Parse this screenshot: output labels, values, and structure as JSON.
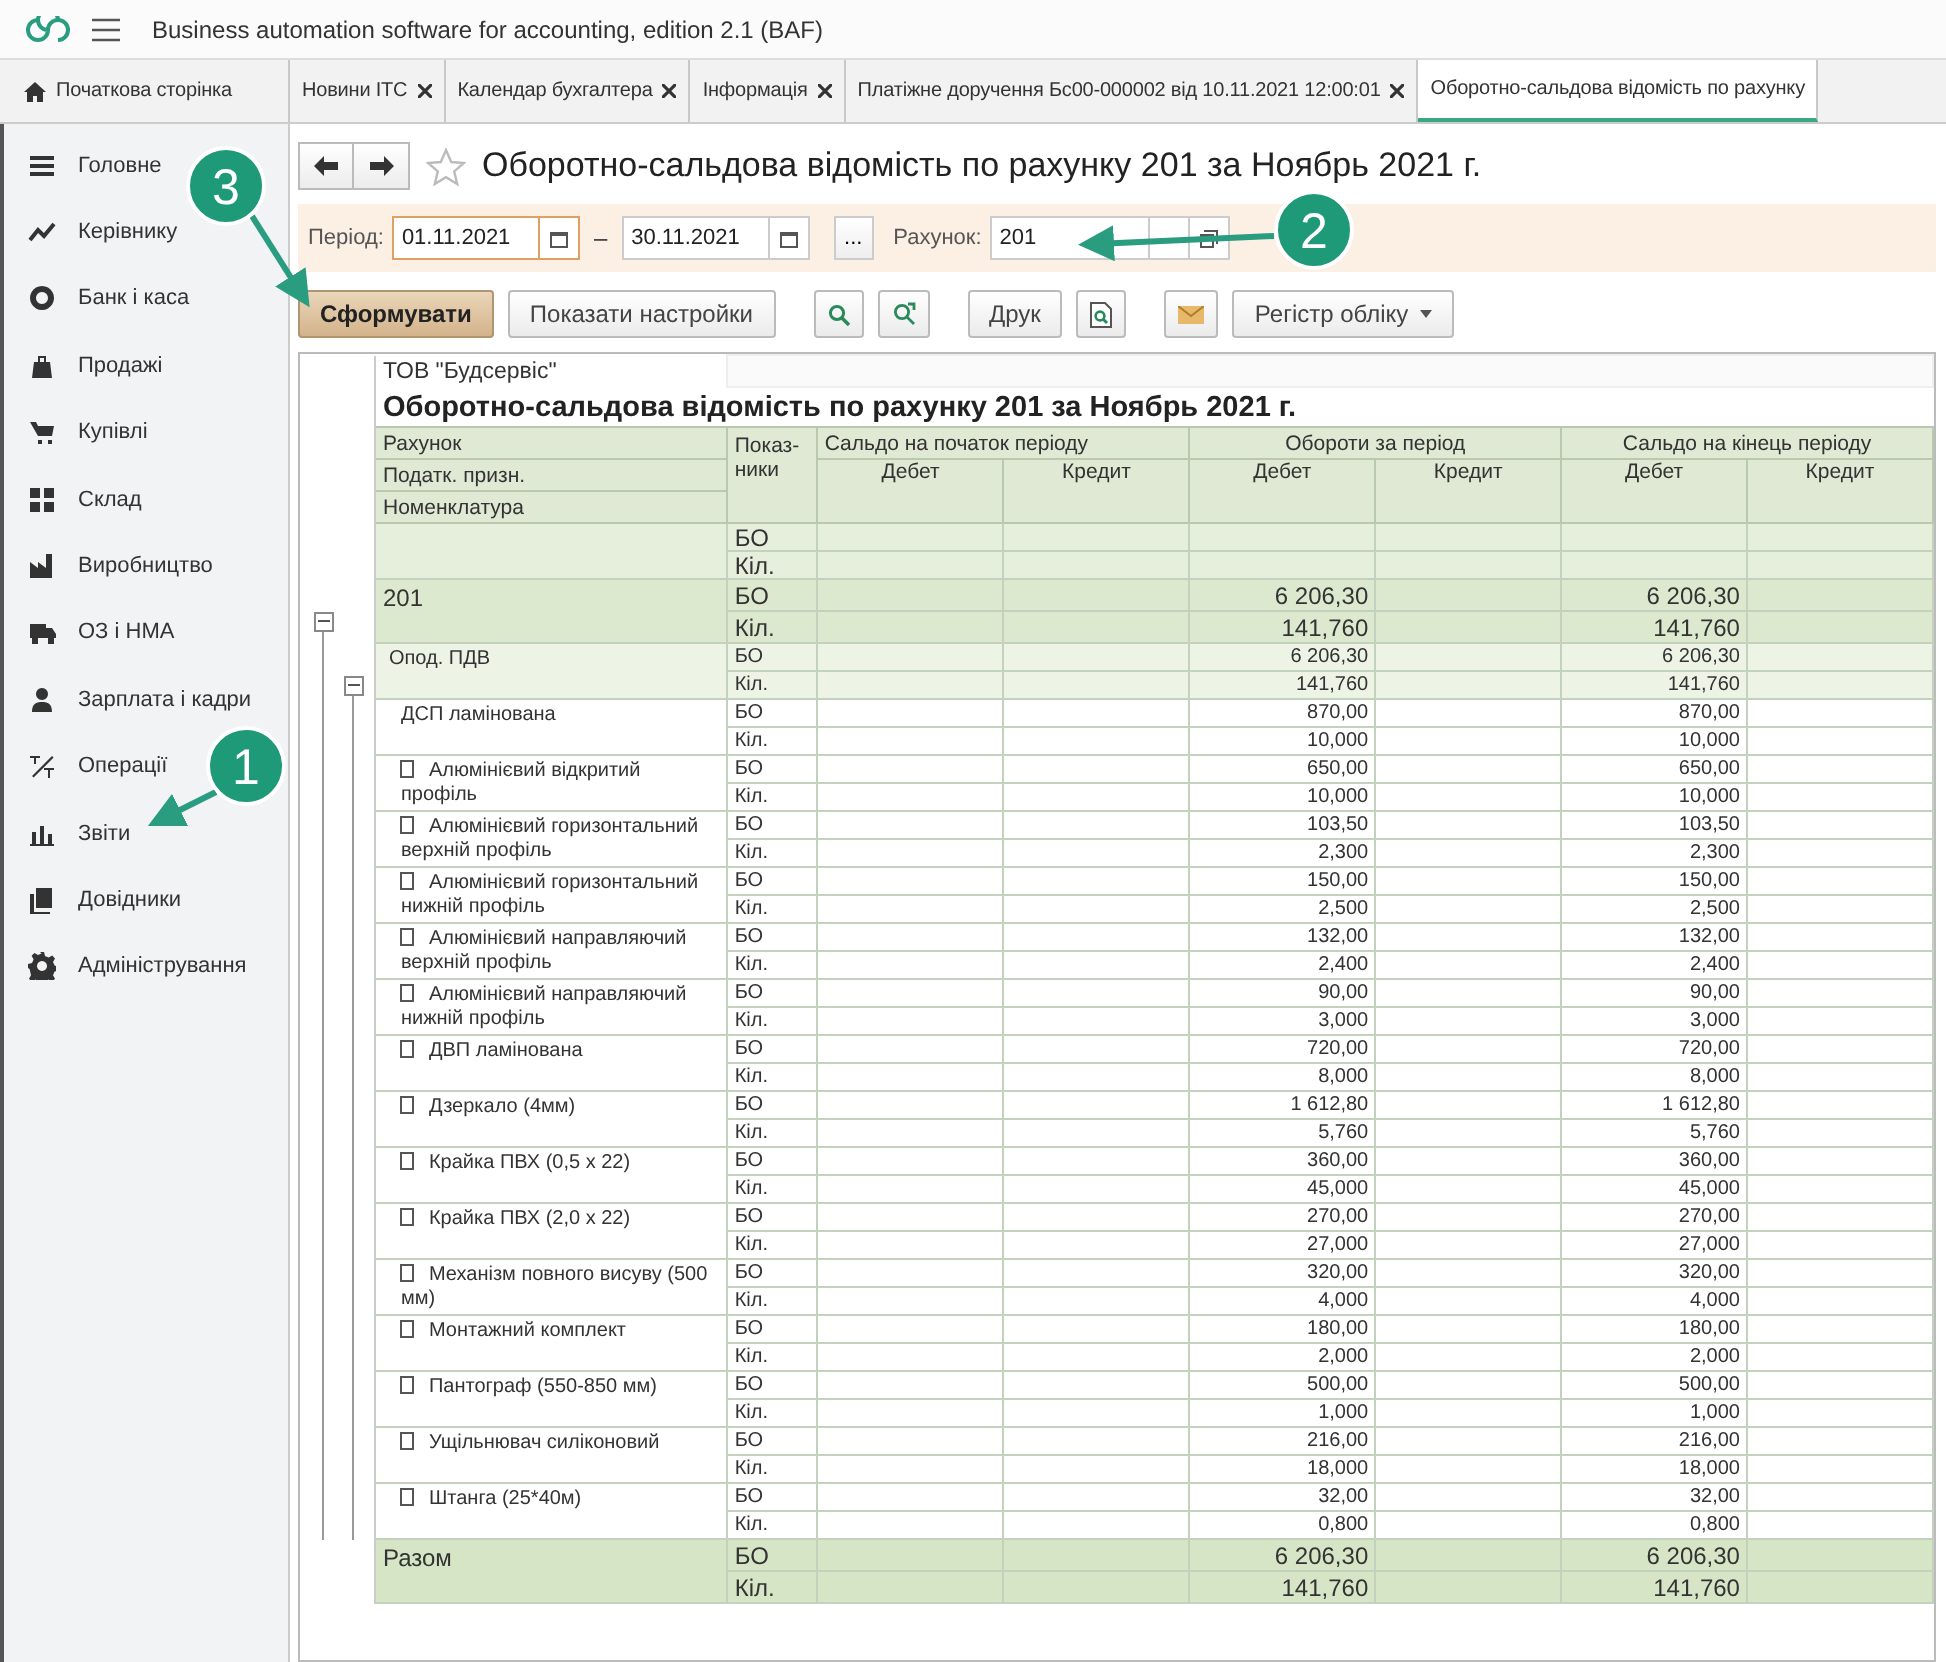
{
  "app": {
    "title": "Business automation software for accounting, edition 2.1 (BAF)"
  },
  "tabs": [
    {
      "label": "Початкова сторінка",
      "kind": "home",
      "closable": false,
      "selected": false
    },
    {
      "label": "Новини ІТС",
      "kind": "page",
      "closable": true,
      "selected": false
    },
    {
      "label": "Календар бухгалтера",
      "kind": "page",
      "closable": true,
      "selected": false
    },
    {
      "label": "Інформація",
      "kind": "page",
      "closable": true,
      "selected": false
    },
    {
      "label": "Платіжне доручення Бс00-000002 від 10.11.2021 12:00:01",
      "kind": "page",
      "closable": true,
      "selected": false
    },
    {
      "label": "Оборотно-сальдова відомість по рахунку",
      "kind": "page",
      "closable": false,
      "selected": true
    }
  ],
  "sidebar": {
    "items": [
      {
        "label": "Головне"
      },
      {
        "label": "Керівнику"
      },
      {
        "label": "Банк і каса"
      },
      {
        "label": "Продажі"
      },
      {
        "label": "Купівлі"
      },
      {
        "label": "Склад"
      },
      {
        "label": "Виробництво"
      },
      {
        "label": "ОЗ і НМА"
      },
      {
        "label": "Зарплата і кадри"
      },
      {
        "label": "Операції"
      },
      {
        "label": "Звіти"
      },
      {
        "label": "Довідники"
      },
      {
        "label": "Адміністрування"
      }
    ]
  },
  "form": {
    "title": "Оборотно-сальдова відомість по рахунку 201 за Ноябрь 2021 г."
  },
  "filters": {
    "period_label": "Період:",
    "date_from": {
      "value": "01.11.2021",
      "focused": true
    },
    "separator": "–",
    "date_to": {
      "value": "30.11.2021",
      "focused": false
    },
    "more_button": "...",
    "account_label": "Рахунок:",
    "account": "201"
  },
  "toolbar": [
    {
      "kind": "primary",
      "label": "Сформувати"
    },
    {
      "kind": "text",
      "label": "Показати настройки"
    },
    {
      "kind": "search"
    },
    {
      "kind": "search-refresh"
    },
    {
      "kind": "text",
      "label": "Друк"
    },
    {
      "kind": "preview"
    },
    {
      "kind": "mail"
    },
    {
      "kind": "dropdown",
      "label": "Регістр обліку"
    }
  ],
  "report": {
    "organization": "ТОВ \"Будсервіс\"",
    "title": "Оборотно-сальдова відомість по рахунку 201 за Ноябрь 2021 г.",
    "row_headers": [
      "Рахунок",
      "Податк. призн.",
      "Номенклатура"
    ],
    "indicator_header": "Показ-ники",
    "column_groups": [
      {
        "label": "Сальдо на початок періоду",
        "columns": [
          "Дебет",
          "Кредит"
        ]
      },
      {
        "label": "Обороти за період",
        "columns": [
          "Дебет",
          "Кредит"
        ]
      },
      {
        "label": "Сальдо на кінець періоду",
        "columns": [
          "Дебет",
          "Кредит"
        ]
      }
    ],
    "blank_row": {
      "lines": [
        {
          "indicator": "БО"
        },
        {
          "indicator": "Кіл."
        }
      ]
    },
    "accounts": [
      {
        "name": "201",
        "expanded": true,
        "lines": [
          {
            "indicator": "БО",
            "turnover_debit": "6 206,30",
            "closing_debit": "6 206,30"
          },
          {
            "indicator": "Кіл.",
            "turnover_debit": "141,760",
            "closing_debit": "141,760"
          }
        ],
        "children": [
          {
            "name": "Опод. ПДВ",
            "expanded": true,
            "lines": [
              {
                "indicator": "БО",
                "turnover_debit": "6 206,30",
                "closing_debit": "6 206,30"
              },
              {
                "indicator": "Кіл.",
                "turnover_debit": "141,760",
                "closing_debit": "141,760"
              }
            ],
            "children": [
              {
                "name": "ДСП ламінована",
                "marker": false,
                "lines": [
                  {
                    "indicator": "БО",
                    "turnover_debit": "870,00",
                    "closing_debit": "870,00"
                  },
                  {
                    "indicator": "Кіл.",
                    "turnover_debit": "10,000",
                    "closing_debit": "10,000"
                  }
                ]
              },
              {
                "name": "Алюмінієвий відкритий профіль",
                "marker": true,
                "lines": [
                  {
                    "indicator": "БО",
                    "turnover_debit": "650,00",
                    "closing_debit": "650,00"
                  },
                  {
                    "indicator": "Кіл.",
                    "turnover_debit": "10,000",
                    "closing_debit": "10,000"
                  }
                ]
              },
              {
                "name": "Алюмінієвий горизонтальний верхній профіль",
                "marker": true,
                "lines": [
                  {
                    "indicator": "БО",
                    "turnover_debit": "103,50",
                    "closing_debit": "103,50"
                  },
                  {
                    "indicator": "Кіл.",
                    "turnover_debit": "2,300",
                    "closing_debit": "2,300"
                  }
                ]
              },
              {
                "name": "Алюмінієвий горизонтальний нижній профіль",
                "marker": true,
                "lines": [
                  {
                    "indicator": "БО",
                    "turnover_debit": "150,00",
                    "closing_debit": "150,00"
                  },
                  {
                    "indicator": "Кіл.",
                    "turnover_debit": "2,500",
                    "closing_debit": "2,500"
                  }
                ]
              },
              {
                "name": "Алюмінієвий направляючий верхній профіль",
                "marker": true,
                "lines": [
                  {
                    "indicator": "БО",
                    "turnover_debit": "132,00",
                    "closing_debit": "132,00"
                  },
                  {
                    "indicator": "Кіл.",
                    "turnover_debit": "2,400",
                    "closing_debit": "2,400"
                  }
                ]
              },
              {
                "name": "Алюмінієвий направляючий нижній профіль",
                "marker": true,
                "lines": [
                  {
                    "indicator": "БО",
                    "turnover_debit": "90,00",
                    "closing_debit": "90,00"
                  },
                  {
                    "indicator": "Кіл.",
                    "turnover_debit": "3,000",
                    "closing_debit": "3,000"
                  }
                ]
              },
              {
                "name": "ДВП ламінована",
                "marker": true,
                "lines": [
                  {
                    "indicator": "БО",
                    "turnover_debit": "720,00",
                    "closing_debit": "720,00"
                  },
                  {
                    "indicator": "Кіл.",
                    "turnover_debit": "8,000",
                    "closing_debit": "8,000"
                  }
                ]
              },
              {
                "name": "Дзеркало (4мм)",
                "marker": true,
                "lines": [
                  {
                    "indicator": "БО",
                    "turnover_debit": "1 612,80",
                    "closing_debit": "1 612,80"
                  },
                  {
                    "indicator": "Кіл.",
                    "turnover_debit": "5,760",
                    "closing_debit": "5,760"
                  }
                ]
              },
              {
                "name": "Крайка ПВХ (0,5 х 22)",
                "marker": true,
                "lines": [
                  {
                    "indicator": "БО",
                    "turnover_debit": "360,00",
                    "closing_debit": "360,00"
                  },
                  {
                    "indicator": "Кіл.",
                    "turnover_debit": "45,000",
                    "closing_debit": "45,000"
                  }
                ]
              },
              {
                "name": "Крайка ПВХ (2,0 х 22)",
                "marker": true,
                "lines": [
                  {
                    "indicator": "БО",
                    "turnover_debit": "270,00",
                    "closing_debit": "270,00"
                  },
                  {
                    "indicator": "Кіл.",
                    "turnover_debit": "27,000",
                    "closing_debit": "27,000"
                  }
                ]
              },
              {
                "name": "Механізм повного висуву (500 мм)",
                "marker": true,
                "lines": [
                  {
                    "indicator": "БО",
                    "turnover_debit": "320,00",
                    "closing_debit": "320,00"
                  },
                  {
                    "indicator": "Кіл.",
                    "turnover_debit": "4,000",
                    "closing_debit": "4,000"
                  }
                ]
              },
              {
                "name": "Монтажний комплект",
                "marker": true,
                "lines": [
                  {
                    "indicator": "БО",
                    "turnover_debit": "180,00",
                    "closing_debit": "180,00"
                  },
                  {
                    "indicator": "Кіл.",
                    "turnover_debit": "2,000",
                    "closing_debit": "2,000"
                  }
                ]
              },
              {
                "name": "Пантограф (550-850 мм)",
                "marker": true,
                "lines": [
                  {
                    "indicator": "БО",
                    "turnover_debit": "500,00",
                    "closing_debit": "500,00"
                  },
                  {
                    "indicator": "Кіл.",
                    "turnover_debit": "1,000",
                    "closing_debit": "1,000"
                  }
                ]
              },
              {
                "name": "Ущільнювач силіконовий",
                "marker": true,
                "lines": [
                  {
                    "indicator": "БО",
                    "turnover_debit": "216,00",
                    "closing_debit": "216,00"
                  },
                  {
                    "indicator": "Кіл.",
                    "turnover_debit": "18,000",
                    "closing_debit": "18,000"
                  }
                ]
              },
              {
                "name": "Штанга (25*40м)",
                "marker": true,
                "lines": [
                  {
                    "indicator": "БО",
                    "turnover_debit": "32,00",
                    "closing_debit": "32,00"
                  },
                  {
                    "indicator": "Кіл.",
                    "turnover_debit": "0,800",
                    "closing_debit": "0,800"
                  }
                ]
              }
            ]
          }
        ]
      }
    ],
    "total": {
      "name": "Разом",
      "lines": [
        {
          "indicator": "БО",
          "turnover_debit": "6 206,30",
          "closing_debit": "6 206,30"
        },
        {
          "indicator": "Кіл.",
          "turnover_debit": "141,760",
          "closing_debit": "141,760"
        }
      ]
    }
  },
  "callouts": [
    {
      "number": "3"
    },
    {
      "number": "2"
    },
    {
      "number": "1"
    }
  ]
}
